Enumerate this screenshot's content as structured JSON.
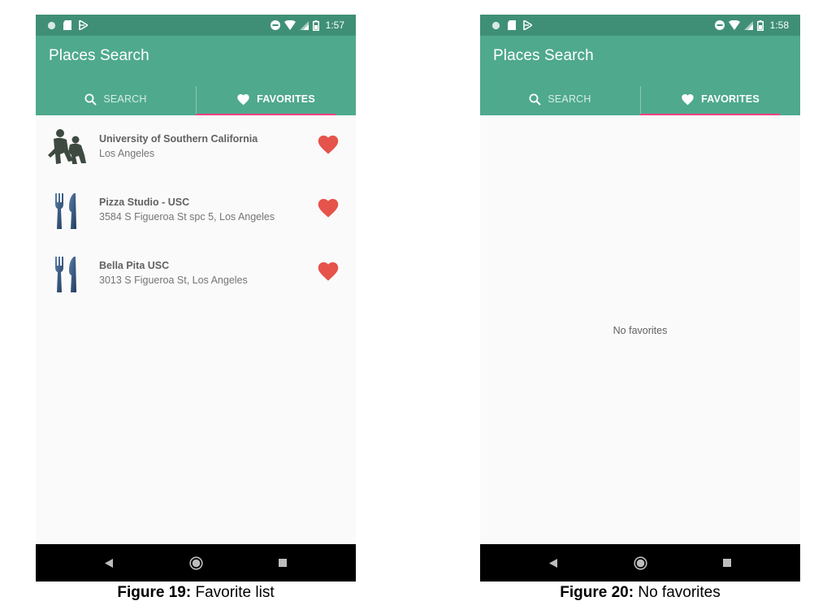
{
  "colors": {
    "status_bar": "#3f8f76",
    "app_bar": "#4fa98d",
    "tab_indicator": "#ff4081",
    "heart": "#e5534b",
    "nav_bar": "#000000",
    "content_bg": "#fafafa"
  },
  "screens": [
    {
      "status_bar": {
        "left_icons": [
          "circle-notification-icon",
          "sd-card-icon",
          "play-store-icon"
        ],
        "right_icons": [
          "do-not-disturb-icon",
          "wifi-icon",
          "signal-icon",
          "battery-icon"
        ],
        "time": "1:57"
      },
      "app_bar": {
        "title": "Places Search"
      },
      "tabs": [
        {
          "label": "SEARCH",
          "icon": "search-icon",
          "selected": false
        },
        {
          "label": "FAVORITES",
          "icon": "heart-icon",
          "selected": true
        }
      ],
      "favorites": [
        {
          "name": "University of Southern California",
          "address": "Los Angeles",
          "icon": "university-icon",
          "favorited": true
        },
        {
          "name": "Pizza Studio - USC",
          "address": "3584 S Figueroa St spc 5, Los Angeles",
          "icon": "restaurant-icon",
          "favorited": true
        },
        {
          "name": "Bella Pita USC",
          "address": "3013 S Figueroa St, Los Angeles",
          "icon": "restaurant-icon",
          "favorited": true
        }
      ],
      "empty_message": "",
      "nav_buttons": [
        "back-icon",
        "home-icon",
        "recents-icon"
      ],
      "caption": {
        "bold": "Figure 19:",
        "text": " Favorite list"
      }
    },
    {
      "status_bar": {
        "left_icons": [
          "circle-notification-icon",
          "sd-card-icon",
          "play-store-icon"
        ],
        "right_icons": [
          "do-not-disturb-icon",
          "wifi-icon",
          "signal-icon",
          "battery-icon"
        ],
        "time": "1:58"
      },
      "app_bar": {
        "title": "Places Search"
      },
      "tabs": [
        {
          "label": "SEARCH",
          "icon": "search-icon",
          "selected": false
        },
        {
          "label": "FAVORITES",
          "icon": "heart-icon",
          "selected": true
        }
      ],
      "favorites": [],
      "empty_message": "No favorites",
      "nav_buttons": [
        "back-icon",
        "home-icon",
        "recents-icon"
      ],
      "caption": {
        "bold": "Figure 20:",
        "text": " No favorites"
      }
    }
  ]
}
